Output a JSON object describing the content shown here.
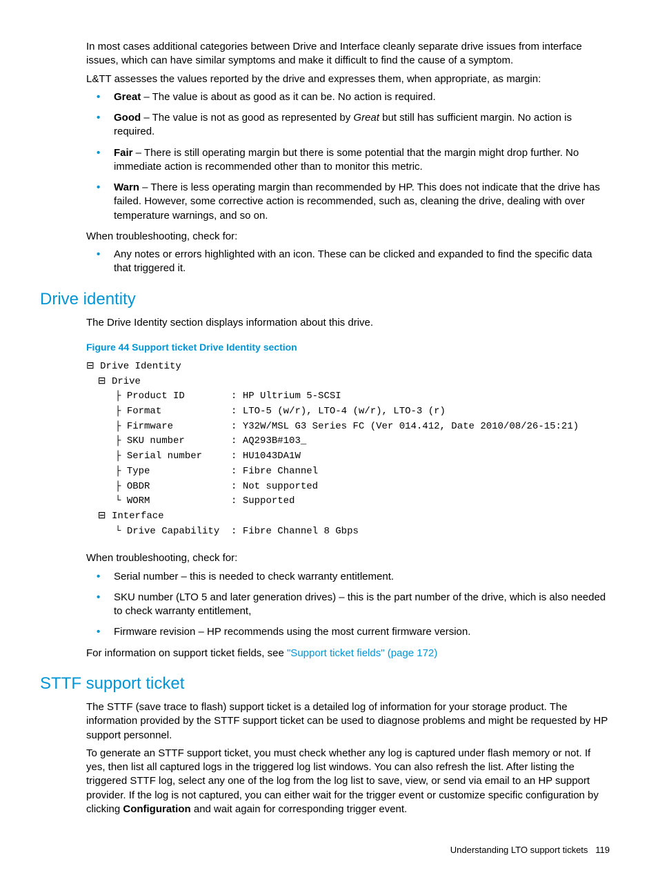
{
  "intro": {
    "p1": "In most cases additional categories between Drive and Interface cleanly separate drive issues from interface issues, which can have similar symptoms and make it difficult to find the cause of a symptom.",
    "p2": "L&TT assesses the values reported by the drive and expresses them, when appropriate, as margin:"
  },
  "margins": [
    {
      "label": "Great",
      "text": " – The value is about as good as it can be. No action is required."
    },
    {
      "label": "Good",
      "text_pre": " – The value is not as good as represented by ",
      "italic": "Great",
      "text_post": " but still has sufficient margin. No action is required."
    },
    {
      "label": "Fair",
      "text": " – There is still operating margin but there is some potential that the margin might drop further. No immediate action is recommended other than to monitor this metric."
    },
    {
      "label": "Warn",
      "text": " – There is less operating margin than recommended by HP. This does not indicate that the drive has failed. However, some corrective action is recommended, such as, cleaning the drive, dealing with over temperature warnings, and so on."
    }
  ],
  "troubleshoot_intro": "When troubleshooting, check for:",
  "troubleshoot_items": [
    "Any notes or errors highlighted with an icon. These can be clicked and expanded to find the specific data that triggered it."
  ],
  "drive_identity": {
    "heading": "Drive identity",
    "desc": "The Drive Identity section displays information about this drive.",
    "fig_caption": "Figure 44 Support ticket Drive Identity section",
    "tree_root": "Drive Identity",
    "tree_drive": "Drive",
    "tree_interface": "Interface",
    "fields": {
      "product_id": {
        "k": "Product ID",
        "v": "HP Ultrium 5-SCSI"
      },
      "format": {
        "k": "Format",
        "v": "LTO-5 (w/r), LTO-4 (w/r), LTO-3 (r)"
      },
      "firmware": {
        "k": "Firmware",
        "v": "Y32W/MSL G3 Series FC (Ver 014.412, Date 2010/08/26-15:21)"
      },
      "sku": {
        "k": "SKU number",
        "v": "AQ293B#103_"
      },
      "serial": {
        "k": "Serial number",
        "v": "HU1043DA1W"
      },
      "type": {
        "k": "Type",
        "v": "Fibre Channel"
      },
      "obdr": {
        "k": "OBDR",
        "v": "Not supported"
      },
      "worm": {
        "k": "WORM",
        "v": "Supported"
      },
      "drive_cap": {
        "k": "Drive Capability",
        "v": "Fibre Channel 8 Gbps"
      }
    },
    "troubleshoot_intro": "When troubleshooting, check for:",
    "troubleshoot_items": [
      "Serial number – this is needed to check warranty entitlement.",
      "SKU number (LTO 5 and later generation drives) – this is the part number of the drive, which is also needed to check warranty entitlement,",
      "Firmware revision – HP recommends using the most current firmware version."
    ],
    "link_pre": "For information on support ticket fields, see ",
    "link_text": "\"Support ticket fields\" (page 172)"
  },
  "sttf": {
    "heading": "STTF support ticket",
    "p1": "The STTF (save trace to flash) support ticket is a detailed log of information for your storage product. The information provided by the STTF support ticket can be used to diagnose problems and might be requested by HP support personnel.",
    "p2_pre": "To generate an STTF support ticket, you must check whether any log is captured under flash memory or not. If yes, then list all captured logs in the triggered log list windows. You can also refresh the list. After listing the triggered STTF log, select any one of the log from the log list to save, view, or send via email to an HP support provider. If the log is not captured, you can either wait for the trigger event or customize specific configuration by clicking ",
    "p2_bold": "Configuration",
    "p2_post": " and wait again for corresponding trigger event."
  },
  "footer": {
    "section": "Understanding LTO support tickets",
    "page": "119"
  }
}
